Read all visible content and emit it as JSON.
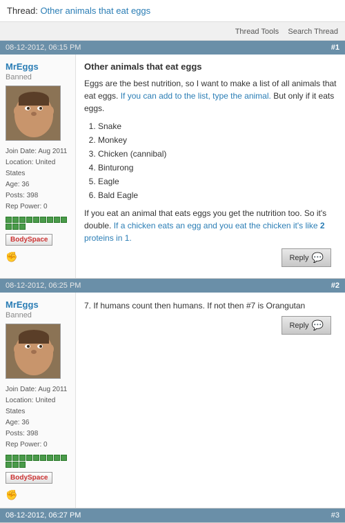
{
  "thread": {
    "label": "Thread:",
    "title": "Other animals that eat eggs"
  },
  "toolbar": {
    "thread_tools": "Thread Tools",
    "search_thread": "Search Thread"
  },
  "posts": [
    {
      "id": 1,
      "date": "08-12-2012, 06:15 PM",
      "post_num": "#1",
      "author": "MrEggs",
      "status": "Banned",
      "join_date": "Aug 2011",
      "location": "United States",
      "age": "36",
      "posts": "398",
      "rep_power": "0",
      "rep_blocks": 12,
      "bodyspace_label": "BODYSPACE",
      "title": "Other animals that eat eggs",
      "content_lines": [
        "Eggs are the best nutrition, so I want to make a list of all animals that eat eggs. If you can add to the list, type the animal. But only if it eats eggs.",
        "",
        "1. Snake",
        "2. Monkey",
        "3. Chicken (cannibal)",
        "4. Binturong",
        "5. Eagle",
        "6. Bald Eagle",
        "",
        "If you eat an animal that eats eggs you get the nutrition too. So it's double. If a chicken eats an egg and you eat the chicken it's like 2 proteins in 1."
      ],
      "reply_label": "Reply"
    },
    {
      "id": 2,
      "date": "08-12-2012, 06:25 PM",
      "post_num": "#2",
      "author": "MrEggs",
      "status": "Banned",
      "join_date": "Aug 2011",
      "location": "United States",
      "age": "36",
      "posts": "398",
      "rep_power": "0",
      "rep_blocks": 12,
      "bodyspace_label": "BODYSPACE",
      "content": "7. If humans count then humans. If not then #7 is Orangutan",
      "reply_label": "Reply"
    }
  ],
  "post3": {
    "date": "08-12-2012, 06:27 PM",
    "post_num": "#3"
  }
}
